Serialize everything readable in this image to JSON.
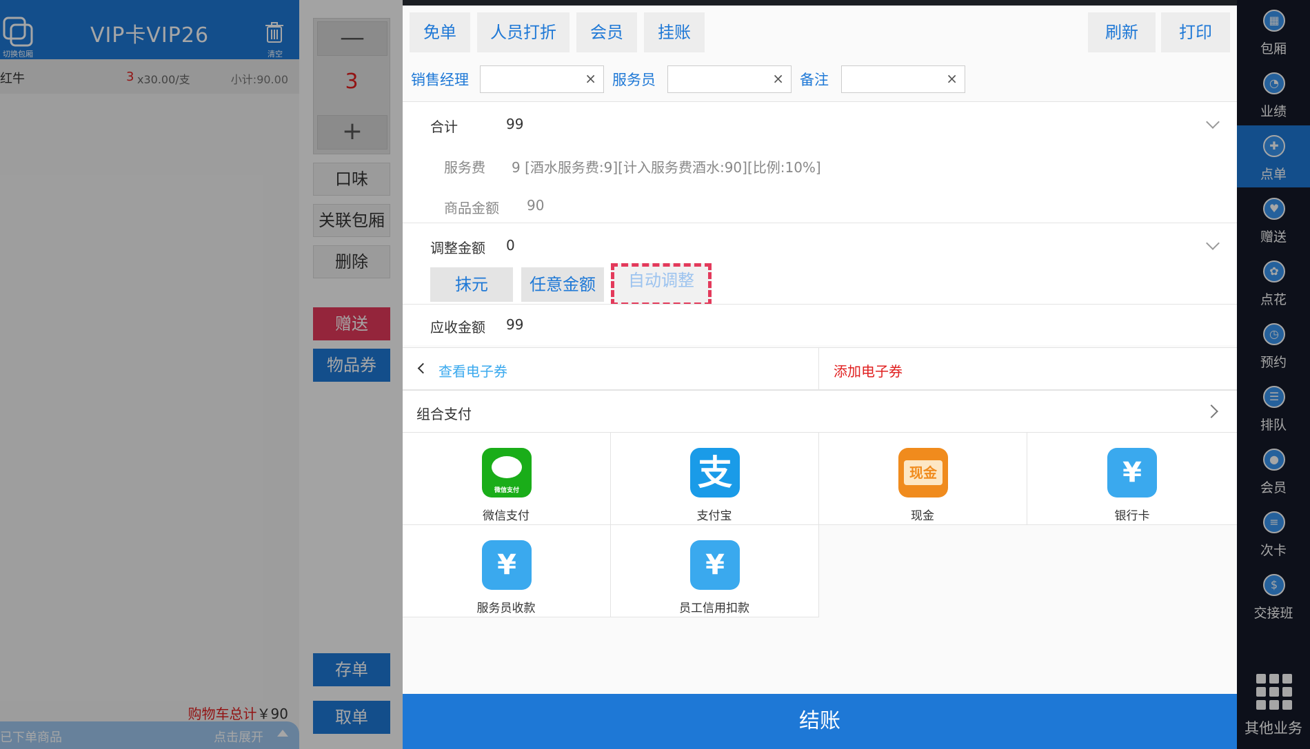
{
  "cart": {
    "title": "VIP卡VIP26",
    "switch_label": "切换包厢",
    "clear_label": "清空",
    "items": [
      {
        "name": "红牛",
        "qty": "3",
        "price": "x30.00/支",
        "subtotal": "小计:90.00"
      }
    ],
    "total_label": "购物车总计",
    "total_value": "￥90",
    "ordered_label": "已下单商品",
    "expand_label": "点击展开"
  },
  "middle": {
    "qty_minus": "—",
    "qty": "3",
    "qty_plus": "+",
    "taste": "口味",
    "link_room": "关联包厢",
    "delete": "删除",
    "gift": "赠送",
    "voucher": "物品券",
    "save_order": "存单",
    "take_order": "取单"
  },
  "toolbar": {
    "free": "免单",
    "staff_discount": "人员打折",
    "member": "会员",
    "credit": "挂账",
    "refresh": "刷新",
    "print": "打印"
  },
  "fields": {
    "sales_manager_label": "销售经理",
    "waiter_label": "服务员",
    "remark_label": "备注",
    "clear_icon": "×"
  },
  "summary": {
    "total_label": "合计",
    "total_value": "99",
    "service_fee_label": "服务费",
    "service_fee_value": "9 [酒水服务费:9][计入服务费酒水:90][比例:10%]",
    "goods_amount_label": "商品金额",
    "goods_amount_value": "90",
    "adjust_label": "调整金额",
    "adjust_value": "0",
    "round_off": "抹元",
    "any_amount": "任意金额",
    "auto_adjust": "自动调整",
    "receivable_label": "应收金额",
    "receivable_value": "99"
  },
  "coupons": {
    "view": "查看电子券",
    "add": "添加电子券"
  },
  "combo_pay": "组合支付",
  "payments": [
    {
      "label": "微信支付",
      "icon": "wechat-pay-icon",
      "color": "#1aad19",
      "glyph": "微信支付"
    },
    {
      "label": "支付宝",
      "icon": "alipay-icon",
      "color": "#1a9be8",
      "glyph": "支"
    },
    {
      "label": "现金",
      "icon": "cash-icon",
      "color": "#f08b1d",
      "glyph": "现金"
    },
    {
      "label": "银行卡",
      "icon": "bank-card-icon",
      "color": "#3aa9ee",
      "glyph": "¥"
    },
    {
      "label": "服务员收款",
      "icon": "waiter-collect-icon",
      "color": "#3aa9ee",
      "glyph": "¥"
    },
    {
      "label": "员工信用扣款",
      "icon": "staff-credit-icon",
      "color": "#3aa9ee",
      "glyph": "¥"
    }
  ],
  "checkout": "结账",
  "sidebar": {
    "items": [
      {
        "label": "包厢",
        "icon": "room-icon"
      },
      {
        "label": "业绩",
        "icon": "performance-icon"
      },
      {
        "label": "点单",
        "icon": "order-icon"
      },
      {
        "label": "赠送",
        "icon": "gift-icon"
      },
      {
        "label": "点花",
        "icon": "flower-icon"
      },
      {
        "label": "预约",
        "icon": "reservation-icon"
      },
      {
        "label": "排队",
        "icon": "queue-icon"
      },
      {
        "label": "会员",
        "icon": "member-icon"
      },
      {
        "label": "次卡",
        "icon": "times-card-icon"
      },
      {
        "label": "交接班",
        "icon": "shift-icon"
      }
    ],
    "other": "其他业务"
  },
  "colors": {
    "primary": "#1e78d6",
    "danger": "#e33a5b",
    "accent_red": "#e02020"
  }
}
